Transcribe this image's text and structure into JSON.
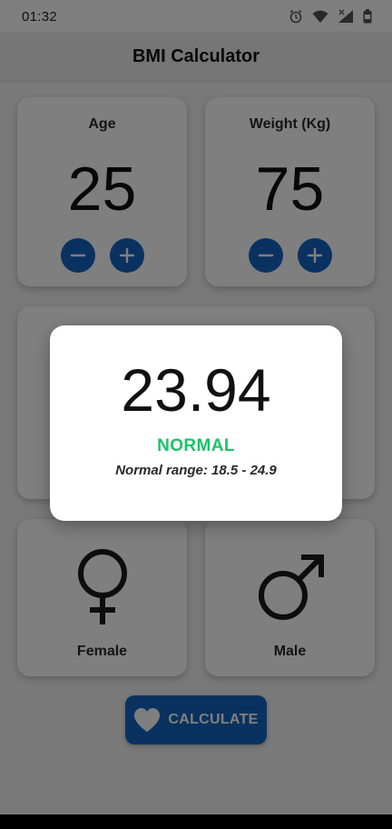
{
  "status_bar": {
    "time": "01:32",
    "icons": [
      "alarm-icon",
      "wifi-icon",
      "signal-icon",
      "battery-icon"
    ]
  },
  "app": {
    "title": "BMI Calculator",
    "accent_color": "#1565c0"
  },
  "age_card": {
    "label": "Age",
    "value": "25",
    "decrement_icon": "minus-icon",
    "increment_icon": "plus-icon"
  },
  "weight_card": {
    "label": "Weight (Kg)",
    "value": "75",
    "decrement_icon": "minus-icon",
    "increment_icon": "plus-icon"
  },
  "gender": {
    "female": {
      "label": "Female",
      "icon": "female-symbol-icon"
    },
    "male": {
      "label": "Male",
      "icon": "male-symbol-icon"
    }
  },
  "calculate_button": {
    "label": "CALCULATE",
    "icon": "heart-icon"
  },
  "result_dialog": {
    "bmi": "23.94",
    "category": "NORMAL",
    "category_color": "#1ec26a",
    "range_text": "Normal range: 18.5 - 24.9"
  }
}
